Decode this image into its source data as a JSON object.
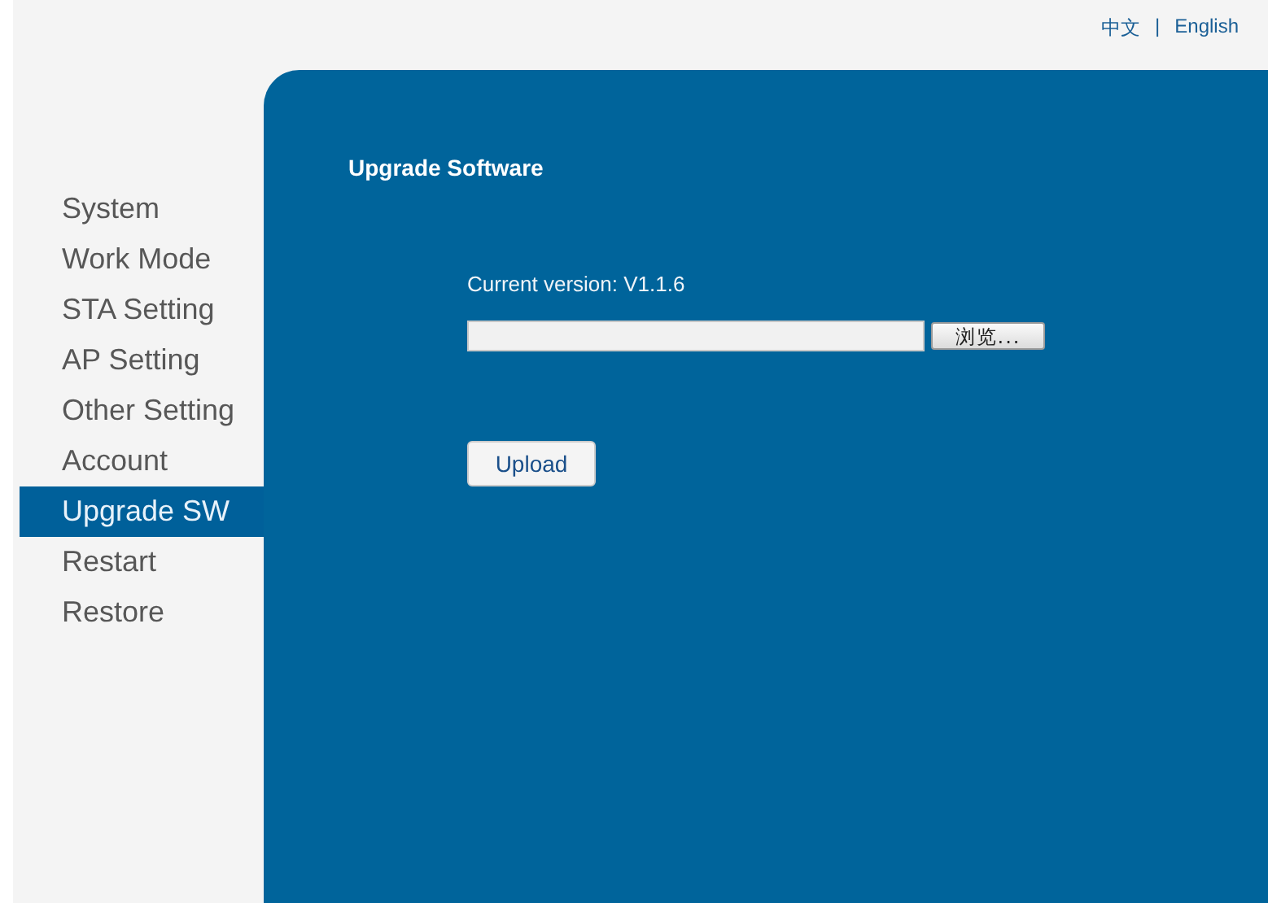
{
  "language_links": [
    "中文",
    "English"
  ],
  "language_separator": "|",
  "sidebar": {
    "items": [
      {
        "label": "System",
        "selected": false
      },
      {
        "label": "Work Mode",
        "selected": false
      },
      {
        "label": "STA Setting",
        "selected": false
      },
      {
        "label": "AP Setting",
        "selected": false
      },
      {
        "label": "Other Setting",
        "selected": false
      },
      {
        "label": "Account",
        "selected": false
      },
      {
        "label": "Upgrade SW",
        "selected": true
      },
      {
        "label": "Restart",
        "selected": false
      },
      {
        "label": "Restore",
        "selected": false
      }
    ]
  },
  "panel": {
    "title": "Upgrade Software",
    "current_version": "Current version: V1.1.6",
    "browse_button": "浏览...",
    "upload_button": "Upload"
  }
}
